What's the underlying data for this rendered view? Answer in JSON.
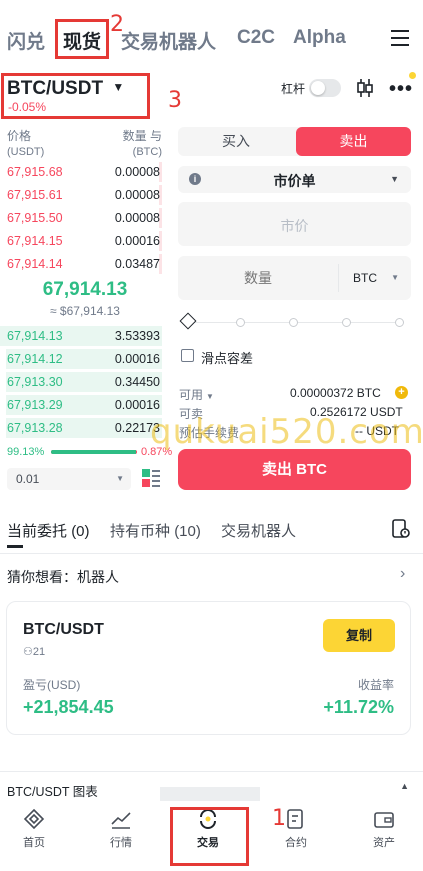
{
  "top_tabs": [
    "闪兑",
    "现货",
    "交易机器人",
    "C2C",
    "Alpha"
  ],
  "pair": {
    "symbol": "BTC/USDT",
    "change": "-0.05%"
  },
  "leverage_label": "杠杆",
  "book_headers": {
    "price": "价格",
    "price_unit": "(USDT)",
    "qty": "数量 与",
    "qty_unit": "(BTC)"
  },
  "asks": [
    {
      "price": "67,915.68",
      "qty": "0.00008"
    },
    {
      "price": "67,915.61",
      "qty": "0.00008"
    },
    {
      "price": "67,915.50",
      "qty": "0.00008"
    },
    {
      "price": "67,914.15",
      "qty": "0.00016"
    },
    {
      "price": "67,914.14",
      "qty": "0.03487"
    }
  ],
  "last_price": "67,914.13",
  "last_price_usd": "≈ $67,914.13",
  "bids": [
    {
      "price": "67,914.13",
      "qty": "3.53393"
    },
    {
      "price": "67,914.12",
      "qty": "0.00016"
    },
    {
      "price": "67,913.30",
      "qty": "0.34450"
    },
    {
      "price": "67,913.29",
      "qty": "0.00016"
    },
    {
      "price": "67,913.28",
      "qty": "0.22173"
    }
  ],
  "ratio": {
    "buy": "99.13%",
    "sell": "0.87%",
    "buy_fraction": 0.9913
  },
  "precision": "0.01",
  "trade": {
    "buy_tab": "买入",
    "sell_tab": "卖出",
    "order_type": "市价单",
    "market_price": "市价",
    "qty_placeholder": "数量",
    "qty_unit": "BTC",
    "slippage": "滑点容差",
    "available_label": "可用",
    "available_value": "0.00000372 BTC",
    "sellable_label": "可卖",
    "sellable_value": "0.2526172 USDT",
    "fee_label": "预估手续费",
    "fee_value": "-- USDT",
    "submit": "卖出 BTC"
  },
  "watermark": "qukuai520.com",
  "order_tabs": {
    "open": "当前委托",
    "open_count": "(0)",
    "holdings": "持有币种",
    "holdings_count": "(10)",
    "bots": "交易机器人"
  },
  "guess": {
    "title": "猜你想看：机器人"
  },
  "bot_card": {
    "pair": "BTC/USDT",
    "users": "21",
    "copy": "复制",
    "pnl_label": "盈亏(USD)",
    "pnl_value": "+21,854.45",
    "yield_label": "收益率",
    "yield_value": "+11.72%"
  },
  "chart_bar": "BTC/USDT 图表",
  "nav": [
    "首页",
    "行情",
    "交易",
    "合约",
    "资产"
  ],
  "annotations": [
    "1",
    "2",
    "3"
  ],
  "colors": {
    "red": "#f6465d",
    "green": "#2ebd85",
    "yellow": "#fcd535",
    "annotation": "#e53935"
  }
}
